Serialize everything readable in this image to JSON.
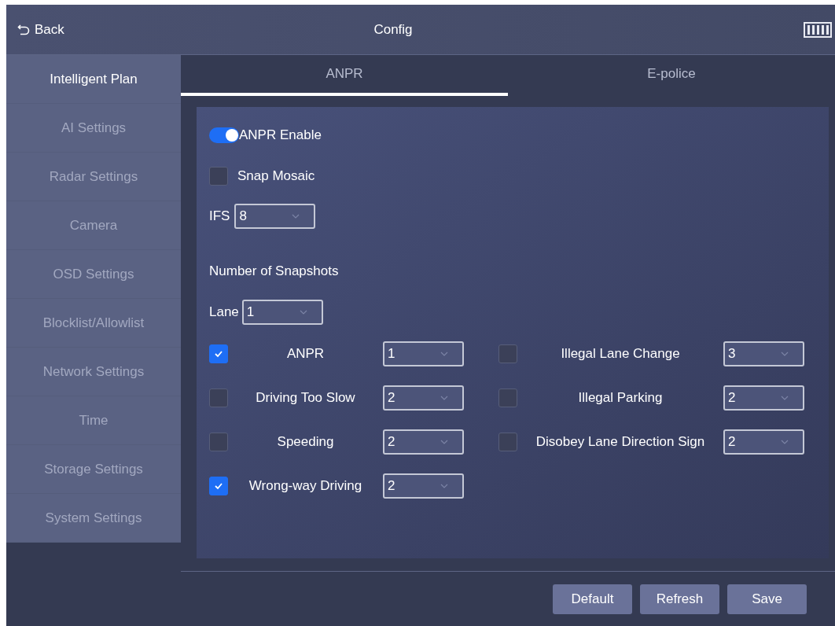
{
  "header": {
    "back_label": "Back",
    "title": "Config"
  },
  "sidebar": {
    "items": [
      {
        "label": "Intelligent Plan",
        "selected": true
      },
      {
        "label": "AI Settings",
        "selected": false
      },
      {
        "label": "Radar Settings",
        "selected": false
      },
      {
        "label": "Camera",
        "selected": false
      },
      {
        "label": "OSD Settings",
        "selected": false
      },
      {
        "label": "Blocklist/Allowlist",
        "selected": false
      },
      {
        "label": "Network Settings",
        "selected": false
      },
      {
        "label": "Time",
        "selected": false
      },
      {
        "label": "Storage Settings",
        "selected": false
      },
      {
        "label": "System Settings",
        "selected": false
      }
    ]
  },
  "tabs": [
    {
      "label": "ANPR",
      "selected": true
    },
    {
      "label": "E-police",
      "selected": false
    }
  ],
  "form": {
    "anpr_enable": {
      "label": "ANPR Enable",
      "on": true
    },
    "snap_mosaic": {
      "label": "Snap Mosaic",
      "checked": false
    },
    "ifs": {
      "label": "IFS",
      "value": "8"
    },
    "snapshots_heading": "Number of Snapshots",
    "lane": {
      "label": "Lane",
      "value": "1"
    },
    "left_column": [
      {
        "label": "ANPR",
        "checked": true,
        "value": "1"
      },
      {
        "label": "Driving Too Slow",
        "checked": false,
        "value": "2"
      },
      {
        "label": "Speeding",
        "checked": false,
        "value": "2"
      },
      {
        "label": "Wrong-way Driving",
        "checked": true,
        "value": "2"
      }
    ],
    "right_column": [
      {
        "label": "Illegal Lane Change",
        "checked": false,
        "value": "3"
      },
      {
        "label": "Illegal Parking",
        "checked": false,
        "value": "2"
      },
      {
        "label": "Disobey Lane Direction Sign",
        "checked": false,
        "value": "2"
      }
    ]
  },
  "buttons": [
    "Default",
    "Refresh",
    "Save"
  ]
}
